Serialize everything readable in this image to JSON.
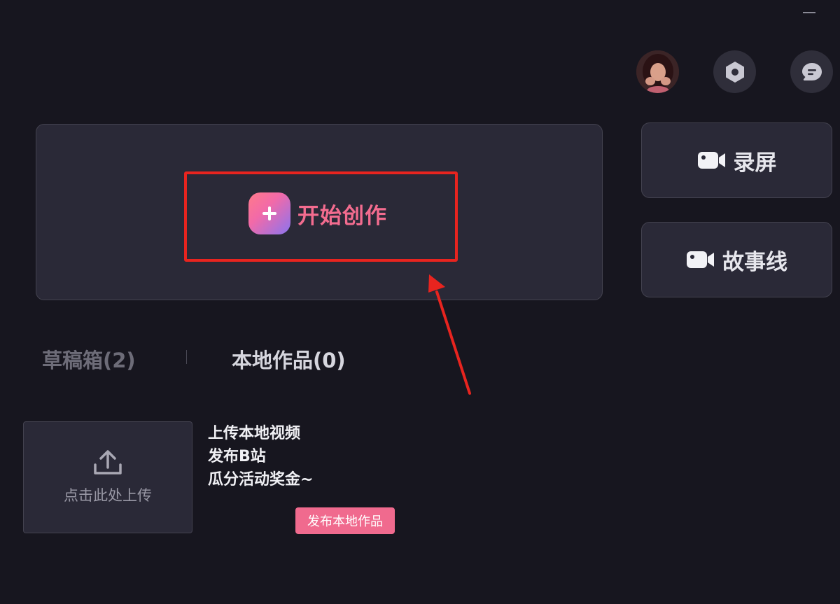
{
  "header": {
    "avatar_icon": "user-avatar",
    "settings_icon": "hexagon-settings-icon",
    "message_icon": "chat-bubble-icon"
  },
  "create": {
    "label": "开始创作",
    "icon": "plus-icon"
  },
  "side_actions": [
    {
      "label": "录屏",
      "icon": "video-camera-icon"
    },
    {
      "label": "故事线",
      "icon": "video-camera-icon"
    }
  ],
  "tabs": [
    {
      "label": "草稿箱(2)"
    },
    {
      "label": "本地作品(0)"
    }
  ],
  "upload": {
    "label": "点击此处上传",
    "icon": "upload-icon"
  },
  "promo": {
    "lines": [
      "上传本地视频",
      "发布B站",
      "瓜分活动奖金~"
    ],
    "button_label": "发布本地作品"
  },
  "colors": {
    "background": "#17161f",
    "card": "#2a2937",
    "accent_pink": "#f36c8f",
    "highlight_red": "#e8241f"
  }
}
